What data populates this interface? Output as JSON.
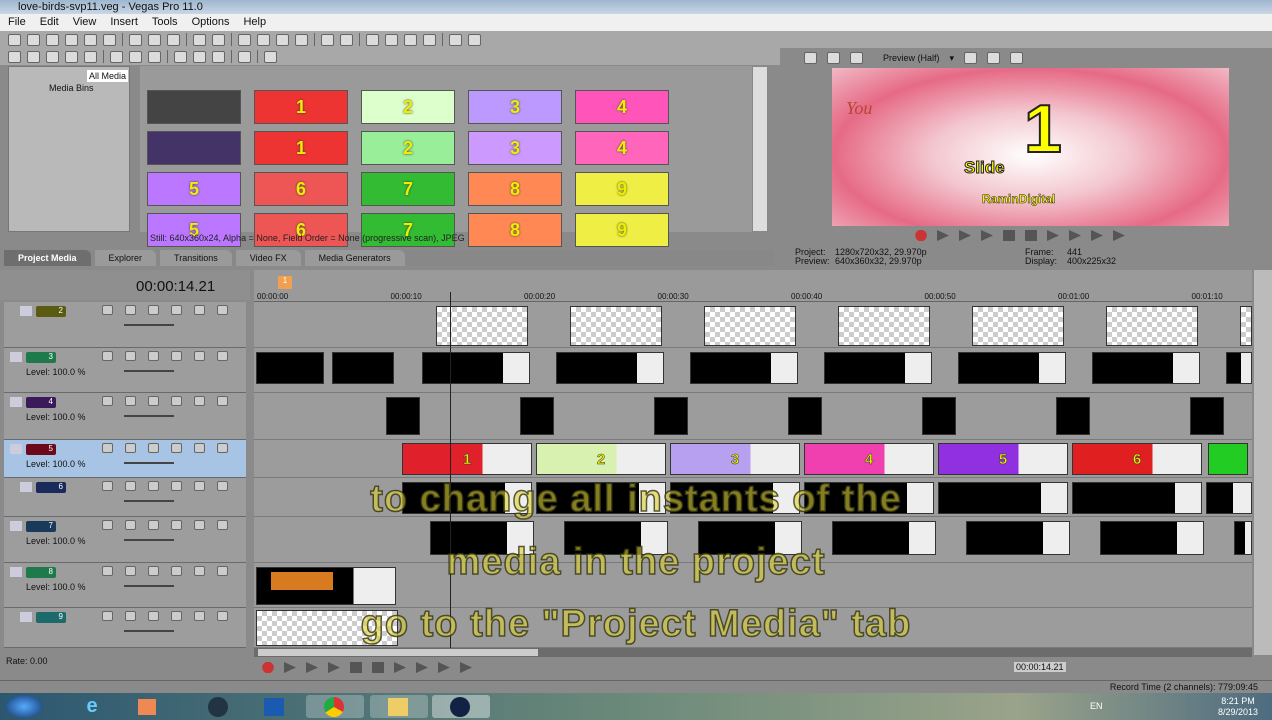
{
  "window": {
    "title": "love-birds-svp11.veg - Vegas Pro 11.0"
  },
  "menu": [
    "File",
    "Edit",
    "View",
    "Insert",
    "Tools",
    "Options",
    "Help"
  ],
  "tree": {
    "all_media": "All Media",
    "media_bins": "Media Bins"
  },
  "thumbs": [
    "",
    "1",
    "2",
    "3",
    "4",
    "",
    "1",
    "2",
    "3",
    "4",
    "5",
    "6",
    "7",
    "8",
    "9",
    "5",
    "6",
    "7",
    "8",
    "9"
  ],
  "media_info": "Still: 640x360x24, Alpha = None, Field Order = None (progressive scan), JPEG",
  "tabs": [
    "Project Media",
    "Explorer",
    "Transitions",
    "Video FX",
    "Media Generators"
  ],
  "preview": {
    "mode": "Preview (Half)",
    "slide_word": "Slide",
    "slide_number": "1",
    "brand": "RaminDigital",
    "script_text": "You",
    "project_label": "Project:",
    "project": "1280x720x32, 29.970p",
    "preview_label": "Preview:",
    "preview": "640x360x32, 29.970p",
    "frame_label": "Frame:",
    "frame": "441",
    "display_label": "Display:",
    "display": "400x225x32"
  },
  "timeline": {
    "timecode": "00:00:14.21",
    "marker": "1",
    "ruler": [
      "00:00:00",
      "00:00:10",
      "00:00:20",
      "00:00:30",
      "00:00:40",
      "00:00:50",
      "00:01:00",
      "00:01:10"
    ],
    "tracks": [
      {
        "num": "2",
        "level": ""
      },
      {
        "num": "3",
        "level": "Level: 100.0 %"
      },
      {
        "num": "4",
        "level": "Level: 100.0 %"
      },
      {
        "num": "5",
        "level": "Level: 100.0 %"
      },
      {
        "num": "6",
        "level": ""
      },
      {
        "num": "7",
        "level": "Level: 100.0 %"
      },
      {
        "num": "8",
        "level": "Level: 100.0 %"
      },
      {
        "num": "9",
        "level": ""
      }
    ],
    "slide_clips": [
      "1",
      "2",
      "3",
      "4",
      "5",
      "6"
    ],
    "rate": "Rate: 0.00",
    "cursor_time": "00:00:14.21"
  },
  "status": {
    "record_time": "Record Time (2 channels): 779:09:45"
  },
  "subtitles": [
    "to change all instants of the",
    "media in the project",
    "go to the \"Project Media\" tab"
  ],
  "taskbar": {
    "lang": "EN",
    "time": "8:21 PM",
    "date": "8/29/2013"
  },
  "colors": {
    "selected_track": "#a8c4e4",
    "clip_colors": [
      "#e0202a",
      "#d8f0b0",
      "#b8a0f0",
      "#f040b0",
      "#9030e0",
      "#e02020"
    ],
    "track_colors": [
      "#5a5a10",
      "#1e7a4a",
      "#3a1a5a",
      "#6a0a1a",
      "#1a2a5a",
      "#1a3a5a",
      "#1e7a4a",
      "#1e6a6a"
    ]
  }
}
